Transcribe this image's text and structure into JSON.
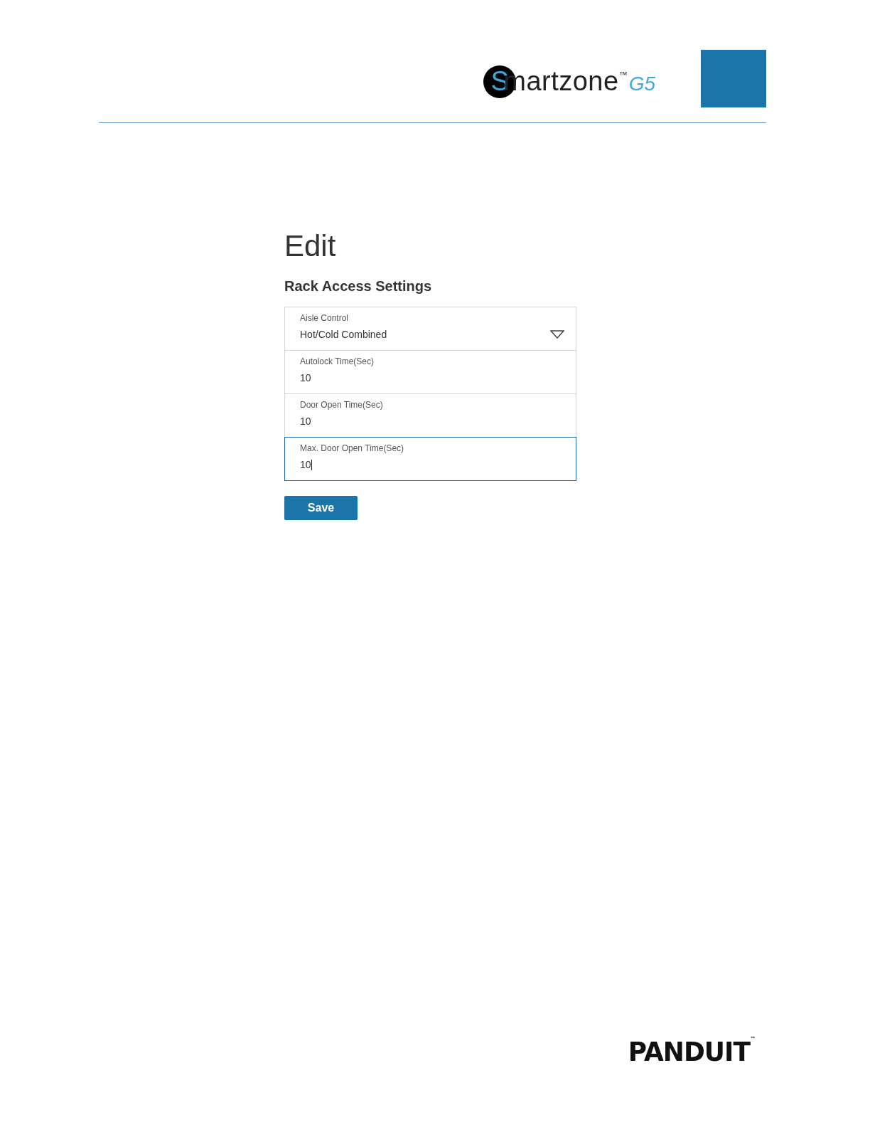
{
  "header": {
    "logo": {
      "initial": "S",
      "rest": "martzone",
      "trademark": "™",
      "version": "G5"
    }
  },
  "title": "Edit",
  "section_title": "Rack Access Settings",
  "fields": [
    {
      "kind": "select",
      "label": "Aisle Control",
      "value": "Hot/Cold Combined",
      "focused": false
    },
    {
      "kind": "text",
      "label": "Autolock Time(Sec)",
      "value": "10",
      "focused": false
    },
    {
      "kind": "text",
      "label": "Door Open Time(Sec)",
      "value": "10",
      "focused": false
    },
    {
      "kind": "text",
      "label": "Max. Door Open Time(Sec)",
      "value": "10",
      "focused": true
    }
  ],
  "save_button": "Save",
  "footer": {
    "brand": "PANDUIT",
    "trademark": "™"
  }
}
